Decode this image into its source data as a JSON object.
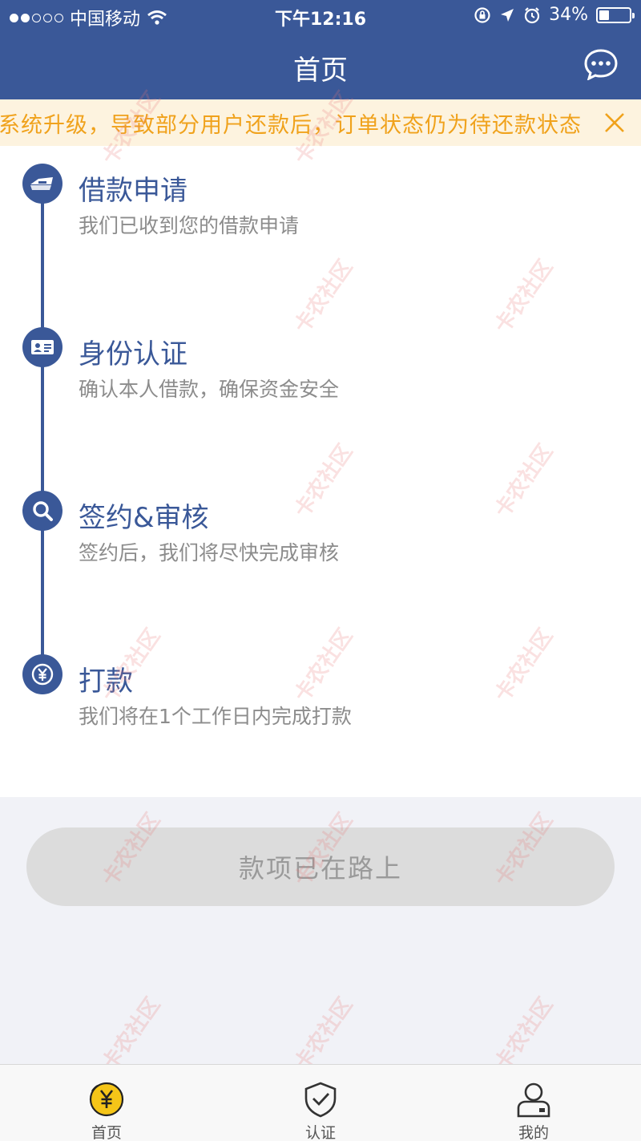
{
  "status_bar": {
    "carrier": "中国移动",
    "time": "下午12:16",
    "battery": "34%",
    "battery_level": 0.34
  },
  "nav": {
    "title": "首页"
  },
  "notice": {
    "text": "系统升级，导致部分用户还款后，订单状态仍为待还款状态"
  },
  "steps": [
    {
      "title": "借款申请",
      "desc": "我们已收到您的借款申请",
      "icon": "loan-application-icon"
    },
    {
      "title": "身份认证",
      "desc": "确认本人借款，确保资金安全",
      "icon": "id-card-icon"
    },
    {
      "title": "签约&审核",
      "desc": "签约后，我们将尽快完成审核",
      "icon": "search-icon"
    },
    {
      "title": "打款",
      "desc": "我们将在1个工作日内完成打款",
      "icon": "yen-coin-icon"
    }
  ],
  "action": {
    "label": "款项已在路上"
  },
  "tabbar": {
    "items": [
      {
        "label": "首页",
        "icon": "yen-coin-icon"
      },
      {
        "label": "认证",
        "icon": "shield-check-icon"
      },
      {
        "label": "我的",
        "icon": "user-icon"
      }
    ]
  },
  "watermark": {
    "text": "卡农社区"
  },
  "colors": {
    "primary": "#3a5898",
    "notice_text": "#f0a21c",
    "notice_bg": "#fdf3df",
    "active_tab": "#f5c518"
  }
}
